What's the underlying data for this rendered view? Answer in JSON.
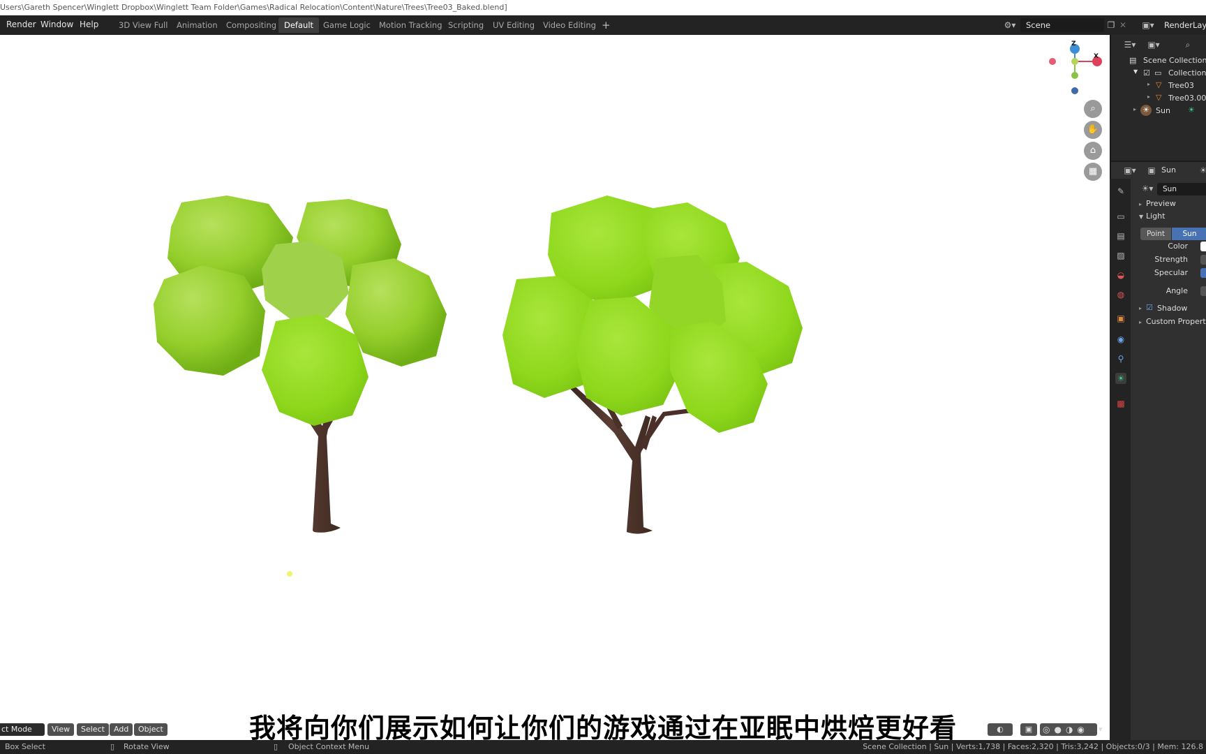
{
  "window": {
    "title": "Users\\Gareth Spencer\\Winglett Dropbox\\Winglett Team Folder\\Games\\Radical Relocation\\Content\\Nature\\Trees\\Tree03_Baked.blend]"
  },
  "topbar": {
    "menus": [
      "Render",
      "Window",
      "Help"
    ],
    "workspace_tabs": [
      {
        "label": "3D View Full",
        "active": false
      },
      {
        "label": "Animation",
        "active": false
      },
      {
        "label": "Compositing",
        "active": false
      },
      {
        "label": "Default",
        "active": true
      },
      {
        "label": "Game Logic",
        "active": false
      },
      {
        "label": "Motion Tracking",
        "active": false
      },
      {
        "label": "Scripting",
        "active": false
      },
      {
        "label": "UV Editing",
        "active": false
      },
      {
        "label": "Video Editing",
        "active": false
      }
    ],
    "add_tab": "+",
    "scene_name": "Scene",
    "render_layer": "RenderLayer"
  },
  "gizmo": {
    "z_label": "Z",
    "x_label": "X",
    "colors": {
      "x": "#e0415a",
      "y": "#8bc34a",
      "z": "#3d8fd6"
    }
  },
  "outliner": {
    "items": [
      {
        "label": "Scene Collection",
        "depth": 0
      },
      {
        "label": "Collection",
        "depth": 1
      },
      {
        "label": "Tree03",
        "depth": 2
      },
      {
        "label": "Tree03.00",
        "depth": 2
      },
      {
        "label": "Sun",
        "depth": 1
      }
    ]
  },
  "properties": {
    "header_object": "Sun",
    "data_name": "Sun",
    "panels": {
      "preview": "Preview",
      "light": "Light",
      "shadow": "Shadow",
      "custom": "Custom Properties"
    },
    "light_types": [
      {
        "label": "Point",
        "active": false
      },
      {
        "label": "Sun",
        "active": true
      }
    ],
    "fields": [
      "Color",
      "Strength",
      "Specular",
      "Angle"
    ],
    "shadow_checked": true
  },
  "viewport_header": {
    "mode": "ct Mode",
    "buttons": [
      "View",
      "Select",
      "Add",
      "Object"
    ]
  },
  "subtitle": "我将向你们展示如何让你们的游戏通过在亚眠中烘焙更好看",
  "statusbar": {
    "left": "Box Select",
    "middle": "Rotate View",
    "right_menu": "Object Context Menu",
    "stats": "Scene Collection | Sun | Verts:1,738 | Faces:2,320 | Tris:3,242 | Objects:0/3 | Mem: 126.8"
  },
  "colors": {
    "accent_blue": "#4772b3",
    "foliage": "#8fd11f",
    "trunk": "#4a3029"
  }
}
